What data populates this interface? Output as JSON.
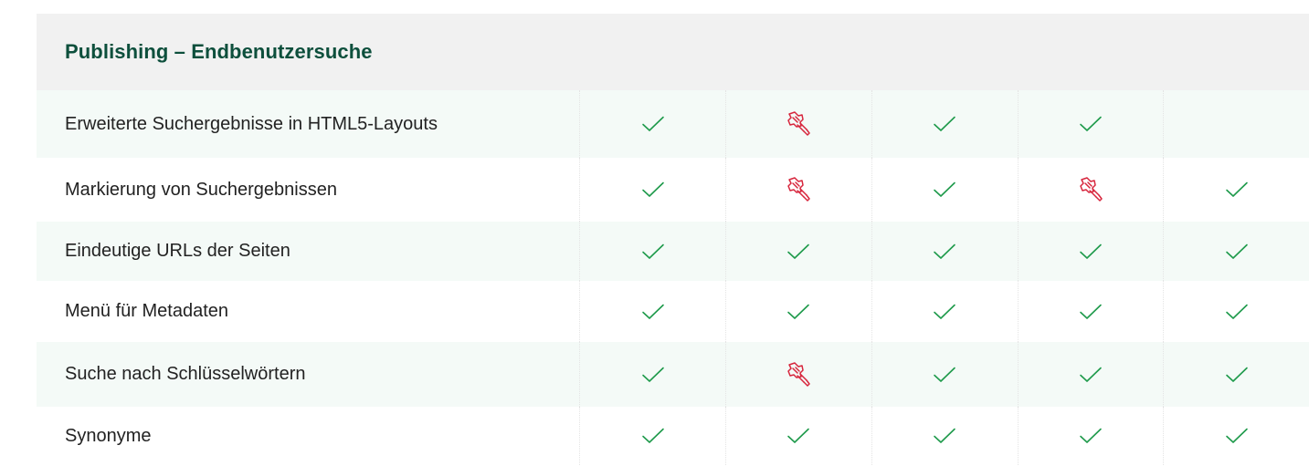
{
  "section": {
    "title": "Publishing – Endbenutzersuche"
  },
  "colors": {
    "title": "#0d4f3c",
    "check": "#1e9a4b",
    "partial": "#d7263d",
    "header_bg": "#f1f1f1",
    "alt_row_bg": "#f4faf7"
  },
  "rows": [
    {
      "label": "Erweiterte Suchergebnisse in HTML5-Layouts",
      "cells": [
        "check-icon",
        "plugin-icon",
        "check-icon",
        "check-icon",
        "none"
      ]
    },
    {
      "label": "Markierung von Suchergebnissen",
      "cells": [
        "check-icon",
        "plugin-icon",
        "check-icon",
        "plugin-icon",
        "check-icon"
      ]
    },
    {
      "label": "Eindeutige URLs der Seiten",
      "cells": [
        "check-icon",
        "check-icon",
        "check-icon",
        "check-icon",
        "check-icon"
      ]
    },
    {
      "label": "Menü für Metadaten",
      "cells": [
        "check-icon",
        "check-icon",
        "check-icon",
        "check-icon",
        "check-icon"
      ]
    },
    {
      "label": "Suche nach Schlüsselwörtern",
      "cells": [
        "check-icon",
        "plugin-icon",
        "check-icon",
        "check-icon",
        "check-icon"
      ]
    },
    {
      "label": "Synonyme",
      "cells": [
        "check-icon",
        "check-icon",
        "check-icon",
        "check-icon",
        "check-icon"
      ]
    }
  ]
}
